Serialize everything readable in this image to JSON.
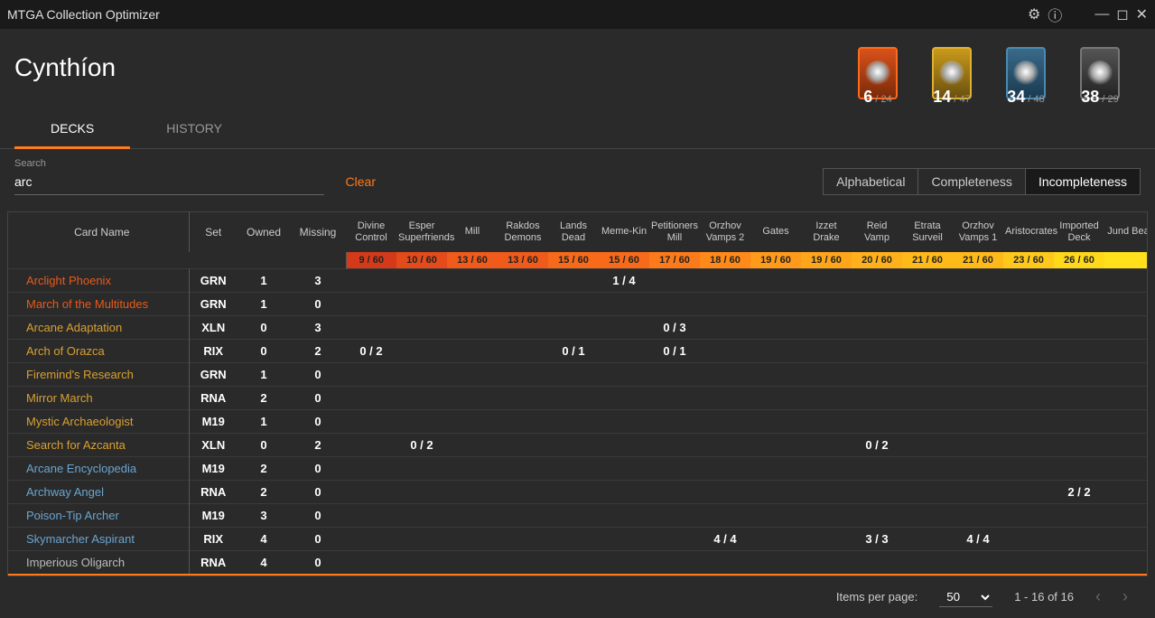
{
  "app_title": "MTGA Collection Optimizer",
  "player_name": "Cynthíon",
  "wildcards": [
    {
      "type": "mythic",
      "owned": 6,
      "total": 24
    },
    {
      "type": "rare",
      "owned": 14,
      "total": 47
    },
    {
      "type": "uncommon",
      "owned": 34,
      "total": 48
    },
    {
      "type": "common",
      "owned": 38,
      "total": 29
    }
  ],
  "tabs": {
    "decks": "DECKS",
    "history": "HISTORY",
    "active": "decks"
  },
  "search": {
    "label": "Search",
    "value": "arc",
    "clear": "Clear"
  },
  "sorts": {
    "alpha": "Alphabetical",
    "comp": "Completeness",
    "incomp": "Incompleteness",
    "active": "incomp"
  },
  "headers": {
    "card_name": "Card Name",
    "set": "Set",
    "owned": "Owned",
    "missing": "Missing"
  },
  "decks": [
    {
      "name": "Divine Control",
      "pct": "9 / 60",
      "color": "#d43a1a"
    },
    {
      "name": "Esper Superfriends",
      "pct": "10 / 60",
      "color": "#e44a1a"
    },
    {
      "name": "Mill",
      "pct": "13 / 60",
      "color": "#f05a1a"
    },
    {
      "name": "Rakdos Demons",
      "pct": "13 / 60",
      "color": "#f05a1a"
    },
    {
      "name": "Lands Dead",
      "pct": "15 / 60",
      "color": "#f76a1a"
    },
    {
      "name": "Meme-Kin",
      "pct": "15 / 60",
      "color": "#f76a1a"
    },
    {
      "name": "Petitioners Mill",
      "pct": "17 / 60",
      "color": "#fc7a1a"
    },
    {
      "name": "Orzhov Vamps 2",
      "pct": "18 / 60",
      "color": "#ff8a1a"
    },
    {
      "name": "Gates",
      "pct": "19 / 60",
      "color": "#ff9a1a"
    },
    {
      "name": "Izzet Drake",
      "pct": "19 / 60",
      "color": "#ffa51a"
    },
    {
      "name": "Reid Vamp",
      "pct": "20 / 60",
      "color": "#ffb01a"
    },
    {
      "name": "Etrata Surveil",
      "pct": "21 / 60",
      "color": "#ffba1a"
    },
    {
      "name": "Orzhov Vamps 1",
      "pct": "21 / 60",
      "color": "#ffba1a"
    },
    {
      "name": "Aristocrates",
      "pct": "23 / 60",
      "color": "#ffc81a"
    },
    {
      "name": "Imported Deck",
      "pct": "26 / 60",
      "color": "#ffd81a"
    },
    {
      "name": "Jund Beat",
      "pct": "",
      "color": "#ffe01a"
    }
  ],
  "rows": [
    {
      "name": "Arclight Phoenix",
      "rarity": "mythic",
      "set": "GRN",
      "owned": 1,
      "missing": 3,
      "cells": [
        "",
        "",
        "",
        "",
        "",
        "1 / 4",
        "",
        "",
        "",
        "",
        "",
        "",
        "",
        "",
        "",
        ""
      ]
    },
    {
      "name": "March of the Multitudes",
      "rarity": "mythic",
      "set": "GRN",
      "owned": 1,
      "missing": 0,
      "cells": [
        "",
        "",
        "",
        "",
        "",
        "",
        "",
        "",
        "",
        "",
        "",
        "",
        "",
        "",
        "",
        ""
      ]
    },
    {
      "name": "Arcane Adaptation",
      "rarity": "rare",
      "set": "XLN",
      "owned": 0,
      "missing": 3,
      "cells": [
        "",
        "",
        "",
        "",
        "",
        "",
        "0 / 3",
        "",
        "",
        "",
        "",
        "",
        "",
        "",
        "",
        ""
      ]
    },
    {
      "name": "Arch of Orazca",
      "rarity": "rare",
      "set": "RIX",
      "owned": 0,
      "missing": 2,
      "cells": [
        "0 / 2",
        "",
        "",
        "",
        "0 / 1",
        "",
        "0 / 1",
        "",
        "",
        "",
        "",
        "",
        "",
        "",
        "",
        ""
      ]
    },
    {
      "name": "Firemind's Research",
      "rarity": "rare",
      "set": "GRN",
      "owned": 1,
      "missing": 0,
      "cells": [
        "",
        "",
        "",
        "",
        "",
        "",
        "",
        "",
        "",
        "",
        "",
        "",
        "",
        "",
        "",
        ""
      ]
    },
    {
      "name": "Mirror March",
      "rarity": "rare",
      "set": "RNA",
      "owned": 2,
      "missing": 0,
      "cells": [
        "",
        "",
        "",
        "",
        "",
        "",
        "",
        "",
        "",
        "",
        "",
        "",
        "",
        "",
        "",
        ""
      ]
    },
    {
      "name": "Mystic Archaeologist",
      "rarity": "rare",
      "set": "M19",
      "owned": 1,
      "missing": 0,
      "cells": [
        "",
        "",
        "",
        "",
        "",
        "",
        "",
        "",
        "",
        "",
        "",
        "",
        "",
        "",
        "",
        ""
      ]
    },
    {
      "name": "Search for Azcanta",
      "rarity": "rare",
      "set": "XLN",
      "owned": 0,
      "missing": 2,
      "cells": [
        "",
        "0 / 2",
        "",
        "",
        "",
        "",
        "",
        "",
        "",
        "",
        "0 / 2",
        "",
        "",
        "",
        "",
        ""
      ]
    },
    {
      "name": "Arcane Encyclopedia",
      "rarity": "uncommon",
      "set": "M19",
      "owned": 2,
      "missing": 0,
      "cells": [
        "",
        "",
        "",
        "",
        "",
        "",
        "",
        "",
        "",
        "",
        "",
        "",
        "",
        "",
        "",
        ""
      ]
    },
    {
      "name": "Archway Angel",
      "rarity": "uncommon",
      "set": "RNA",
      "owned": 2,
      "missing": 0,
      "cells": [
        "",
        "",
        "",
        "",
        "",
        "",
        "",
        "",
        "",
        "",
        "",
        "",
        "",
        "",
        "2 / 2",
        ""
      ]
    },
    {
      "name": "Poison-Tip Archer",
      "rarity": "uncommon",
      "set": "M19",
      "owned": 3,
      "missing": 0,
      "cells": [
        "",
        "",
        "",
        "",
        "",
        "",
        "",
        "",
        "",
        "",
        "",
        "",
        "",
        "",
        "",
        ""
      ]
    },
    {
      "name": "Skymarcher Aspirant",
      "rarity": "uncommon",
      "set": "RIX",
      "owned": 4,
      "missing": 0,
      "cells": [
        "",
        "",
        "",
        "",
        "",
        "",
        "",
        "4 / 4",
        "",
        "",
        "3 / 3",
        "",
        "4 / 4",
        "",
        "",
        ""
      ]
    },
    {
      "name": "Imperious Oligarch",
      "rarity": "common",
      "set": "RNA",
      "owned": 4,
      "missing": 0,
      "cells": [
        "",
        "",
        "",
        "",
        "",
        "",
        "",
        "",
        "",
        "",
        "",
        "",
        "",
        "",
        "",
        ""
      ]
    }
  ],
  "footer": {
    "items_per_page_label": "Items per page:",
    "items_per_page": "50",
    "range": "1 - 16 of 16"
  }
}
